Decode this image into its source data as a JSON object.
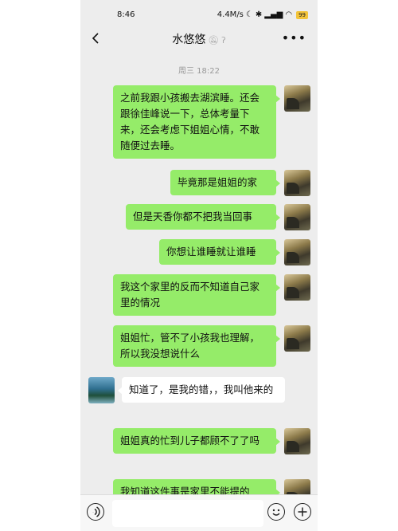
{
  "status_bar": {
    "time": "8:46",
    "network_speed": "4.4M/s",
    "battery": "99"
  },
  "header": {
    "title": "水悠悠",
    "icons": [
      "back-icon",
      "mute-icon",
      "ear-icon",
      "more-icon"
    ]
  },
  "chat": {
    "timestamp": "周三 18:22",
    "messages": [
      {
        "from": "me",
        "text": "之前我跟小孩搬去湖滨睡。还会跟徐佳峰说一下，总体考量下来，还会考虑下姐姐心情，不敢随便过去睡。"
      },
      {
        "from": "me",
        "text": "毕竟那是姐姐的家"
      },
      {
        "from": "me",
        "text": "但是天香你都不把我当回事"
      },
      {
        "from": "me",
        "text": "你想让谁睡就让谁睡"
      },
      {
        "from": "me",
        "text": "我这个家里的反而不知道自己家里的情况"
      },
      {
        "from": "me",
        "text": "姐姐忙，管不了小孩我也理解，所以我没想说什么"
      },
      {
        "from": "other",
        "text": "知道了，是我的错，，我叫他来的"
      },
      {
        "from": "me",
        "text": "姐姐真的忙到儿子都顾不了了吗"
      },
      {
        "from": "me",
        "text": "我知道这件事是家里不能提的"
      }
    ]
  },
  "input_bar": {
    "placeholder": "",
    "icons": [
      "voice-icon",
      "emoji-icon",
      "plus-icon"
    ]
  },
  "colors": {
    "outgoing_bubble": "#95ec69",
    "incoming_bubble": "#ffffff",
    "background": "#ededed"
  }
}
